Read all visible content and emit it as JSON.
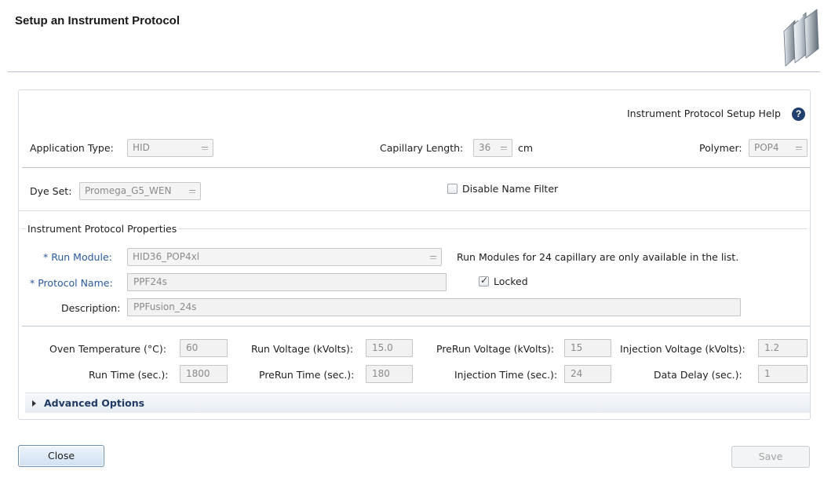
{
  "window": {
    "title": "Setup an Instrument Protocol"
  },
  "help": {
    "label": "Instrument Protocol Setup Help",
    "icon": "help-icon"
  },
  "application_type": {
    "label": "Application Type:",
    "value": "HID"
  },
  "capillary_length": {
    "label": "Capillary Length:",
    "value": "36",
    "unit": "cm"
  },
  "polymer": {
    "label": "Polymer:",
    "value": "POP4"
  },
  "dye_set": {
    "label": "Dye Set:",
    "value": "Promega_G5_WEN"
  },
  "disable_name_filter": {
    "label": "Disable Name Filter",
    "checked": false
  },
  "properties": {
    "legend": "Instrument Protocol Properties",
    "run_module": {
      "label": "Run Module:",
      "required_mark": "*",
      "value": "HID36_POP4xl",
      "note": "Run Modules for 24 capillary are only available in the list."
    },
    "protocol_name": {
      "label": "Protocol Name:",
      "required_mark": "*",
      "value": "PPF24s"
    },
    "locked": {
      "label": "Locked",
      "checked": true
    },
    "description": {
      "label": "Description:",
      "value": "PPFusion_24s"
    }
  },
  "parameters": {
    "oven_temperature": {
      "label": "Oven Temperature (°C):",
      "value": "60"
    },
    "run_voltage": {
      "label": "Run Voltage (kVolts):",
      "value": "15.0"
    },
    "prerun_voltage": {
      "label": "PreRun Voltage (kVolts):",
      "value": "15"
    },
    "injection_voltage": {
      "label": "Injection Voltage (kVolts):",
      "value": "1.2"
    },
    "run_time": {
      "label": "Run Time (sec.):",
      "value": "1800"
    },
    "prerun_time": {
      "label": "PreRun Time (sec.):",
      "value": "180"
    },
    "injection_time": {
      "label": "Injection Time (sec.):",
      "value": "24"
    },
    "data_delay": {
      "label": "Data Delay (sec.):",
      "value": "1"
    }
  },
  "advanced_options": {
    "label": "Advanced Options",
    "expanded": false
  },
  "buttons": {
    "close": "Close",
    "save": "Save"
  },
  "colors": {
    "required_label": "#2a5a9a",
    "advanced_text": "#1f3b66",
    "help_icon": "#1f3f6e",
    "close_button_border": "#6f8fb3"
  }
}
